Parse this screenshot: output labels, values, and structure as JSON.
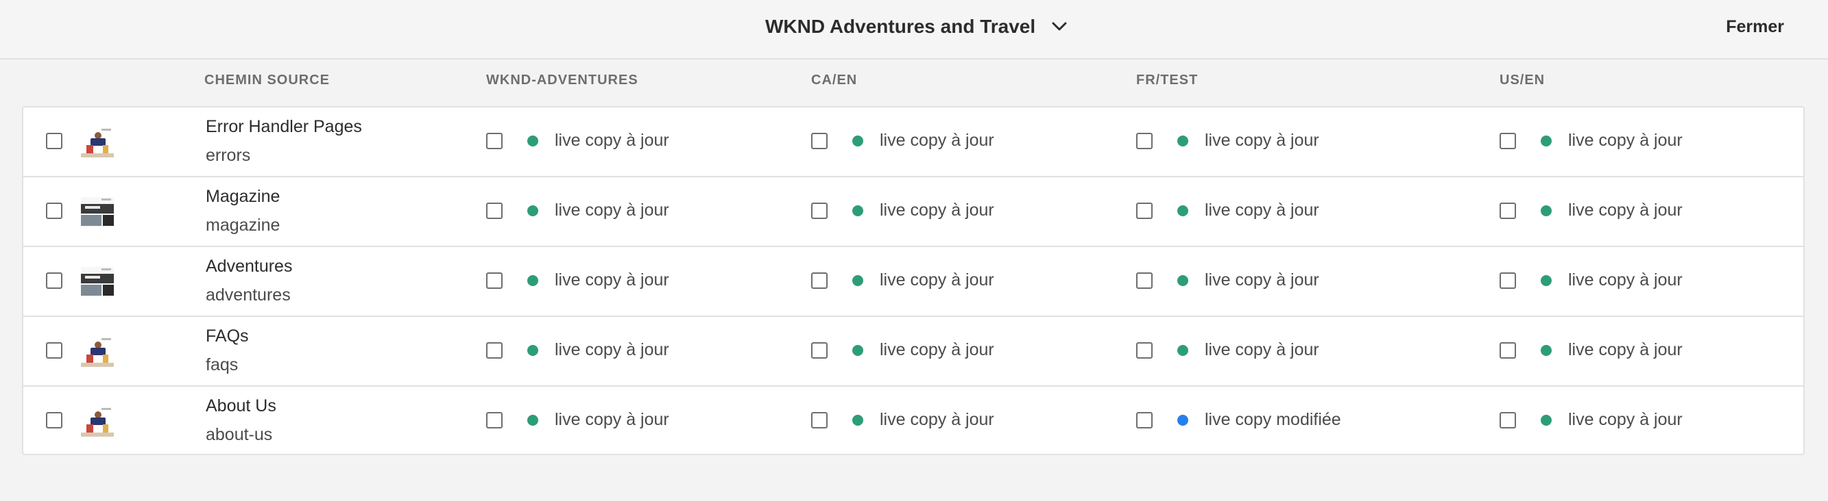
{
  "header": {
    "title": "WKND Adventures and Travel",
    "close_label": "Fermer"
  },
  "columns": [
    "CHEMIN SOURCE",
    "WKND-ADVENTURES",
    "CA/EN",
    "FR/TEST",
    "US/EN"
  ],
  "colors": {
    "status_up_to_date": "#2d9d78",
    "status_modified": "#2680eb"
  },
  "rows": [
    {
      "title": "Error Handler Pages",
      "path": "errors",
      "thumb": "runner-thumbnail",
      "cells": [
        {
          "label": "live copy à jour",
          "status": "up_to_date"
        },
        {
          "label": "live copy à jour",
          "status": "up_to_date"
        },
        {
          "label": "live copy à jour",
          "status": "up_to_date"
        },
        {
          "label": "live copy à jour",
          "status": "up_to_date"
        }
      ]
    },
    {
      "title": "Magazine",
      "path": "magazine",
      "thumb": "magazine-thumbnail",
      "cells": [
        {
          "label": "live copy à jour",
          "status": "up_to_date"
        },
        {
          "label": "live copy à jour",
          "status": "up_to_date"
        },
        {
          "label": "live copy à jour",
          "status": "up_to_date"
        },
        {
          "label": "live copy à jour",
          "status": "up_to_date"
        }
      ]
    },
    {
      "title": "Adventures",
      "path": "adventures",
      "thumb": "magazine-thumbnail",
      "cells": [
        {
          "label": "live copy à jour",
          "status": "up_to_date"
        },
        {
          "label": "live copy à jour",
          "status": "up_to_date"
        },
        {
          "label": "live copy à jour",
          "status": "up_to_date"
        },
        {
          "label": "live copy à jour",
          "status": "up_to_date"
        }
      ]
    },
    {
      "title": "FAQs",
      "path": "faqs",
      "thumb": "runner-thumbnail",
      "cells": [
        {
          "label": "live copy à jour",
          "status": "up_to_date"
        },
        {
          "label": "live copy à jour",
          "status": "up_to_date"
        },
        {
          "label": "live copy à jour",
          "status": "up_to_date"
        },
        {
          "label": "live copy à jour",
          "status": "up_to_date"
        }
      ]
    },
    {
      "title": "About Us",
      "path": "about-us",
      "thumb": "runner-thumbnail",
      "cells": [
        {
          "label": "live copy à jour",
          "status": "up_to_date"
        },
        {
          "label": "live copy à jour",
          "status": "up_to_date"
        },
        {
          "label": "live copy modifiée",
          "status": "modified"
        },
        {
          "label": "live copy à jour",
          "status": "up_to_date"
        }
      ]
    }
  ]
}
